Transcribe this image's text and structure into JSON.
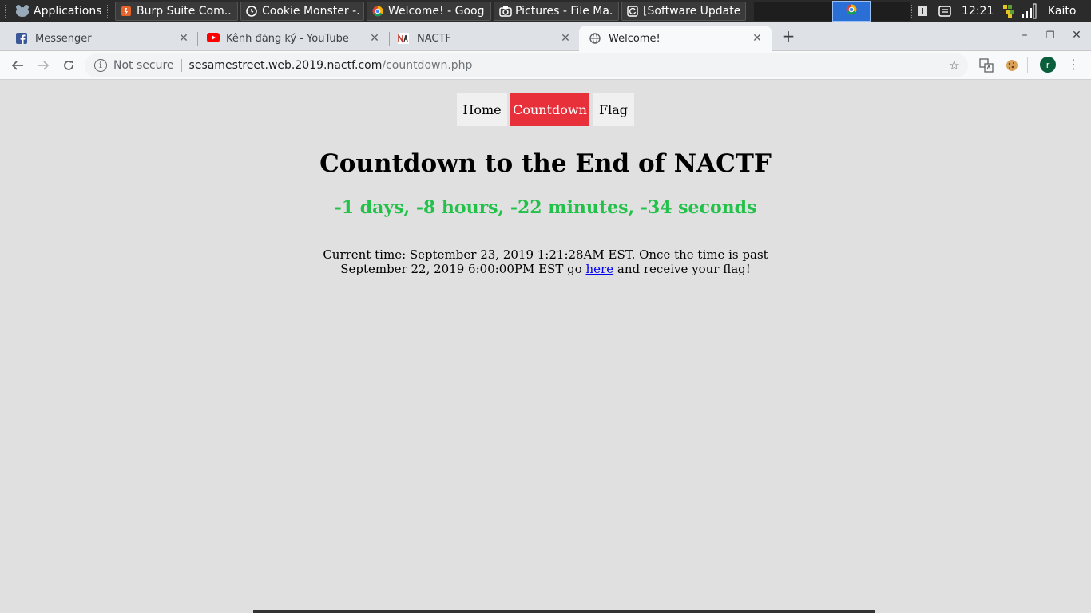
{
  "taskbar": {
    "apps_label": "Applications",
    "tasks": [
      {
        "label": "Burp Suite Com...",
        "icon": "burp-icon"
      },
      {
        "label": "Cookie Monster -...",
        "icon": "clock-app-icon"
      },
      {
        "label": "Welcome! - Goog...",
        "icon": "chrome-icon"
      },
      {
        "label": "Pictures - File Ma...",
        "icon": "camera-icon"
      },
      {
        "label": "[Software Updater]",
        "icon": "updater-icon"
      }
    ],
    "clock": "12:21",
    "user": "Kaito"
  },
  "tabs": [
    {
      "label": "Messenger",
      "icon": "facebook-icon",
      "active": false
    },
    {
      "label": "Kênh đăng ký - YouTube",
      "icon": "youtube-icon",
      "active": false
    },
    {
      "label": "NACTF",
      "icon": "nactf-icon",
      "active": false
    },
    {
      "label": "Welcome!",
      "icon": "globe-icon",
      "active": true
    }
  ],
  "omnibox": {
    "security_text": "Not secure",
    "host": "sesamestreet.web.2019.nactf.com",
    "path": "/countdown.php"
  },
  "profile_initial": "r",
  "page": {
    "nav": [
      {
        "label": "Home",
        "active": false
      },
      {
        "label": "Countdown",
        "active": true
      },
      {
        "label": "Flag",
        "active": false
      }
    ],
    "heading": "Countdown to the End of NACTF",
    "countdown": "-1 days, -8 hours, -22 minutes, -34 seconds",
    "info_before": "Current time: September 23, 2019 1:21:28AM EST. Once the time is past September 22, 2019 6:00:00PM EST go",
    "info_link": "here",
    "info_after": "and receive your flag!"
  },
  "colors": {
    "active_nav": "#e8303a",
    "countdown": "#22c14a",
    "page_bg": "#e0e0e0",
    "link": "#0000ee"
  }
}
